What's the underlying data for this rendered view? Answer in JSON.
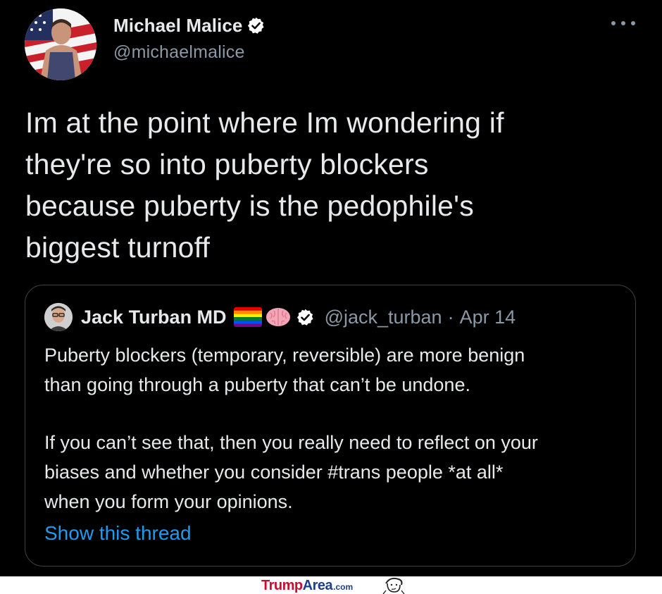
{
  "author": {
    "name": "Michael Malice",
    "handle": "@michaelmalice",
    "verified_icon": "verified-badge-icon",
    "more_icon": "more-options-icon"
  },
  "tweet": {
    "lines": [
      "Im at the point where Im wondering if",
      "they're so into puberty blockers",
      "because puberty is the pedophile's",
      "biggest turnoff"
    ]
  },
  "quoted_tweet": {
    "name": "Jack Turban MD",
    "emoji": [
      "rainbow-flag-icon",
      "brain-icon"
    ],
    "handle": "@jack_turban",
    "separator": "·",
    "date": "Apr 14",
    "paragraph1": [
      "Puberty blockers (temporary, reversible) are more benign",
      "than going through a puberty that can’t be undone."
    ],
    "paragraph2": [
      "If you can’t see that, then you really need to reflect on your",
      "biases and whether you consider #trans people *at all*",
      "when you form your opinions."
    ],
    "show_thread": "Show this thread"
  },
  "watermark": {
    "trump": "Trump",
    "area": "Area",
    "com": ".com"
  },
  "colors": {
    "background": "#000000",
    "text": "#e7e9ea",
    "secondary": "#8b98a5",
    "link": "#1d9bf0",
    "verified": "#ffffff",
    "border": "#3e4144"
  }
}
